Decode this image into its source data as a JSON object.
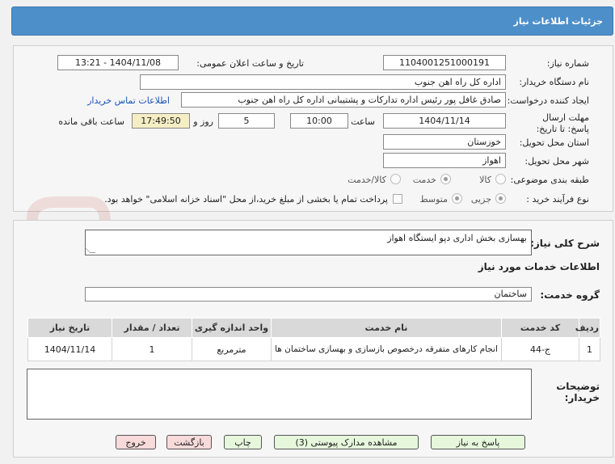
{
  "header": {
    "title": "جزئیات اطلاعات نیاز"
  },
  "form": {
    "need_number_label": "شماره نیاز:",
    "need_number": "1104001251000191",
    "announce_label": "تاریخ و ساعت اعلان عمومی:",
    "announce_value": "1404/11/08 - 13:21",
    "buyer_org_label": "نام دستگاه خریدار:",
    "buyer_org": "اداره کل راه اهن جنوب",
    "requester_label": "ایجاد کننده درخواست:",
    "requester": "صادق غافل پور رئیس اداره تدارکات و پشتیبانی اداره کل راه اهن جنوب",
    "contact_link": "اطلاعات تماس خریدار",
    "deadline_label": "مهلت ارسال پاسخ: تا تاریخ:",
    "deadline_date": "1404/11/14",
    "time_label": "ساعت",
    "deadline_time": "10:00",
    "days_value": "5",
    "days_label": "روز و",
    "remaining_time": "17:49:50",
    "remaining_label": "ساعت باقی مانده",
    "province_label": "استان محل تحویل:",
    "province": "خوزستان",
    "city_label": "شهر محل تحویل:",
    "city": "اهواز",
    "category_label": "طبقه بندی موضوعی:",
    "category_options": [
      "کالا",
      "خدمت",
      "کالا/خدمت"
    ],
    "category_selected": "خدمت",
    "process_label": "نوع فرآیند خرید :",
    "process_options": [
      "جزیی",
      "متوسط"
    ],
    "process_selected": "جزیی",
    "payment_note": "پرداخت تمام یا بخشی از مبلغ خرید،از محل \"اسناد خزانه اسلامی\" خواهد بود."
  },
  "details": {
    "summary_label": "شرح کلی نیاز:",
    "summary": "بهسازی بخش اداری دپو ایستگاه اهواز",
    "services_heading": "اطلاعات خدمات مورد نیاز",
    "service_group_label": "گروه خدمت:",
    "service_group": "ساختمان",
    "table": {
      "headers": [
        "ردیف",
        "کد خدمت",
        "نام خدمت",
        "واحد اندازه گیری",
        "تعداد / مقدار",
        "تاریخ نیاز"
      ],
      "rows": [
        [
          "1",
          "ج-44",
          "انجام کارهای متفرقه درخصوص بازسازی و بهسازی ساختمان ها",
          "مترمربع",
          "1",
          "1404/11/14"
        ]
      ]
    },
    "buyer_notes_label": "توضیحات خریدار:",
    "buyer_notes": ""
  },
  "buttons": {
    "reply": "پاسخ به نیاز",
    "view_docs": "مشاهده مدارک پیوستی (3)",
    "print": "چاپ",
    "back": "بازگشت",
    "exit": "خروج"
  },
  "watermark_text": "AriaTender.net",
  "colors": {
    "header_bg": "#4d8fc9",
    "highlight": "#f5eec4",
    "link": "#1a53b6"
  }
}
